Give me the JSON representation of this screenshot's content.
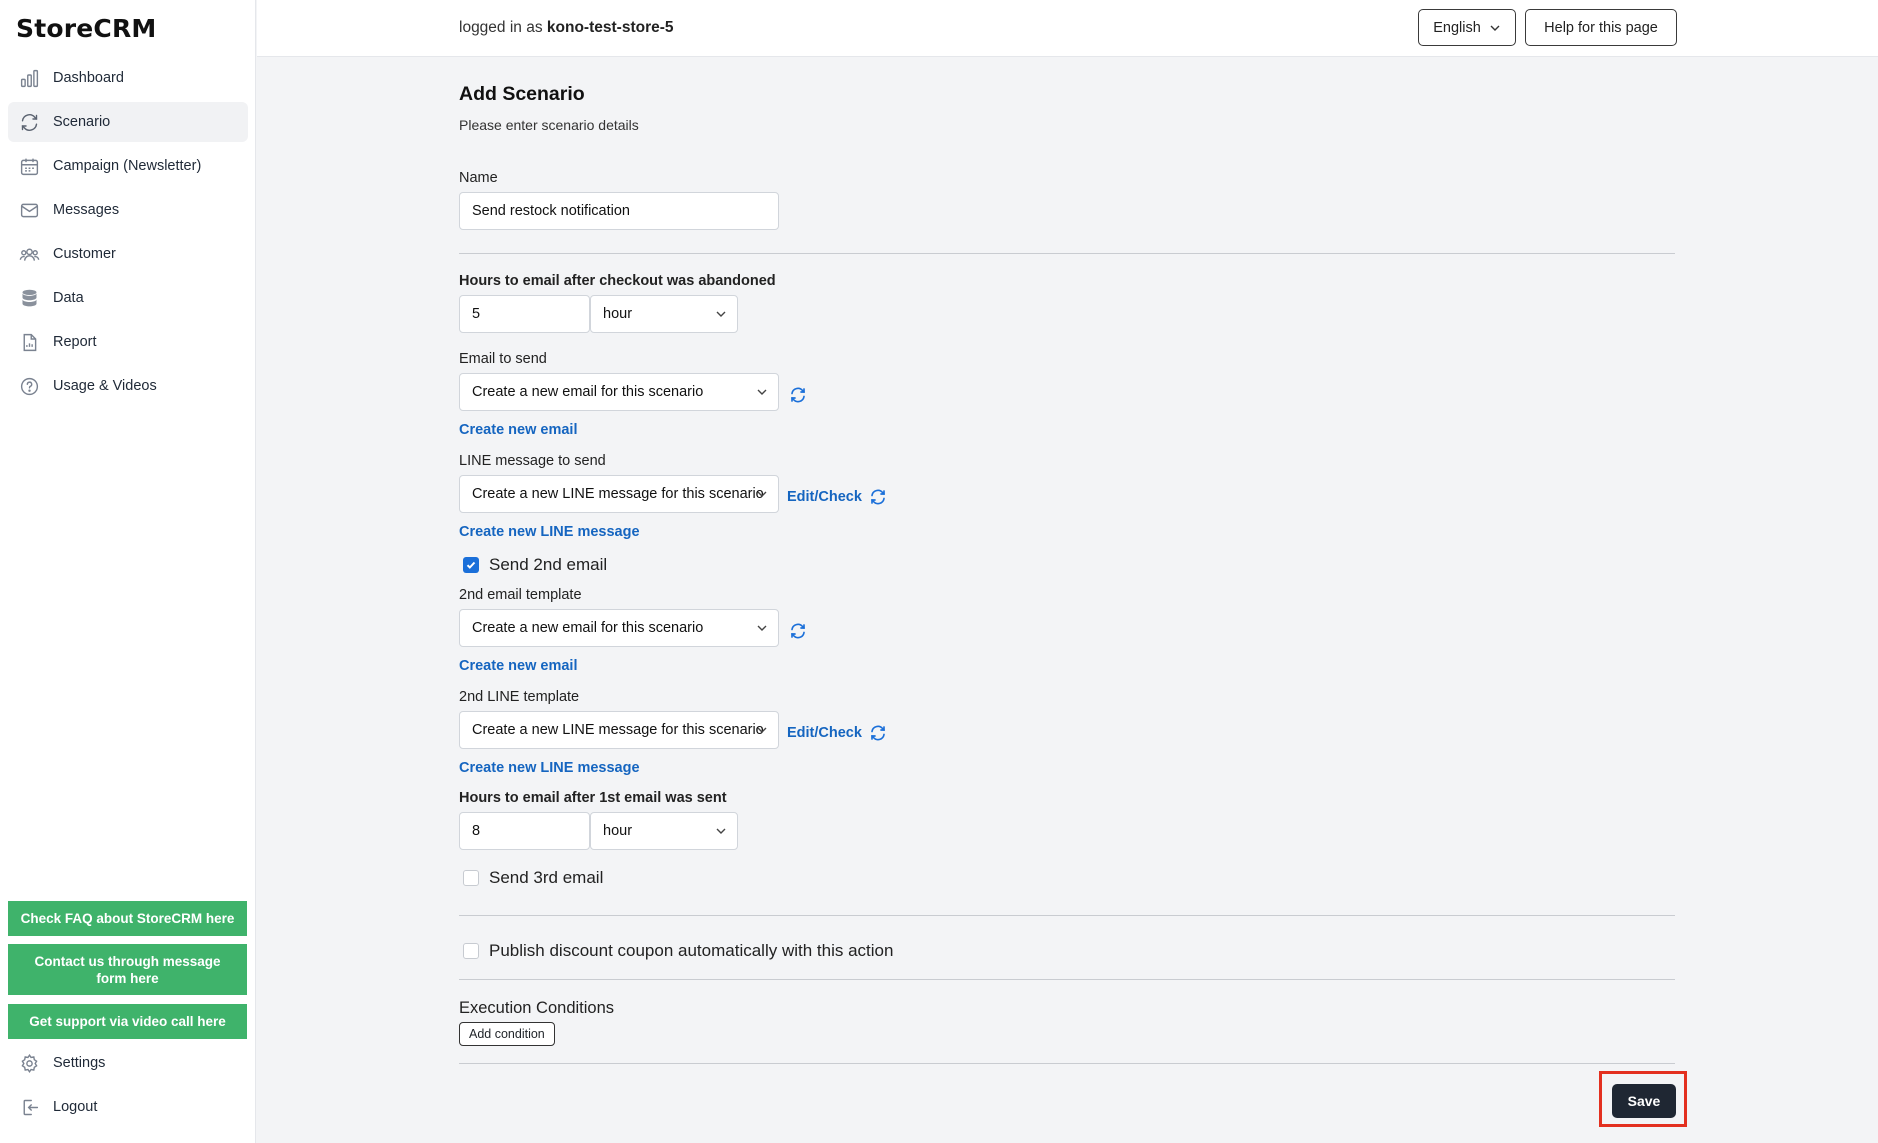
{
  "app": {
    "logo": "StoreCRM"
  },
  "sidebar": {
    "items": [
      {
        "label": "Dashboard",
        "icon": "bar-chart-icon"
      },
      {
        "label": "Scenario",
        "icon": "refresh-cycle-icon",
        "active": true
      },
      {
        "label": "Campaign (Newsletter)",
        "icon": "calendar-icon"
      },
      {
        "label": "Messages",
        "icon": "envelope-icon"
      },
      {
        "label": "Customer",
        "icon": "users-icon"
      },
      {
        "label": "Data",
        "icon": "database-icon"
      },
      {
        "label": "Report",
        "icon": "document-chart-icon"
      },
      {
        "label": "Usage & Videos",
        "icon": "question-circle-icon"
      }
    ],
    "support_buttons": [
      "Check FAQ about StoreCRM here",
      "Contact us through message form here",
      "Get support via video call here"
    ],
    "bottom_items": [
      {
        "label": "Settings",
        "icon": "gear-icon"
      },
      {
        "label": "Logout",
        "icon": "logout-icon"
      }
    ]
  },
  "header": {
    "logged_in_prefix": "logged in as",
    "username": "kono-test-store-5",
    "language": "English",
    "help_button": "Help for this page"
  },
  "form": {
    "title": "Add Scenario",
    "subtitle": "Please enter scenario details",
    "name_label": "Name",
    "name_value": "Send restock notification",
    "hours_label": "Hours to email after checkout was abandoned",
    "hours_value": "5",
    "hours_unit": "hour",
    "email_label": "Email to send",
    "email_value": "Create a new email for this scenario",
    "create_email_link": "Create new email",
    "line_label": "LINE message to send",
    "line_value": "Create a new LINE message for this scenario",
    "edit_check": "Edit/Check",
    "create_line_link": "Create new LINE message",
    "send_2nd_label": "Send 2nd email",
    "send_2nd_checked": true,
    "email2_label": "2nd email template",
    "email2_value": "Create a new email for this scenario",
    "create_email2_link": "Create new email",
    "line2_label": "2nd LINE template",
    "line2_value": "Create a new LINE message for this scenario",
    "edit_check2": "Edit/Check",
    "create_line2_link": "Create new LINE message",
    "hours2_label": "Hours to email after 1st email was sent",
    "hours2_value": "8",
    "hours2_unit": "hour",
    "send_3rd_label": "Send 3rd email",
    "send_3rd_checked": false,
    "coupon_label": "Publish discount coupon automatically with this action",
    "coupon_checked": false,
    "exec_title": "Execution Conditions",
    "add_condition": "Add condition",
    "save": "Save"
  },
  "colors": {
    "accent": "#1565c0",
    "green": "#3fb36b",
    "save_bg": "#1f2733",
    "highlight": "#e3301f"
  }
}
